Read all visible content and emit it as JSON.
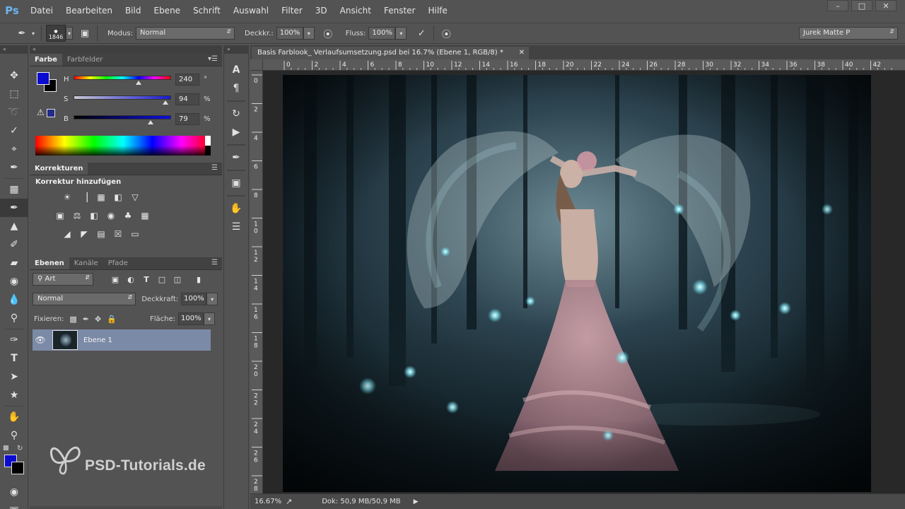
{
  "app": {
    "logo": "Ps",
    "menu": [
      "Datei",
      "Bearbeiten",
      "Bild",
      "Ebene",
      "Schrift",
      "Auswahl",
      "Filter",
      "3D",
      "Ansicht",
      "Fenster",
      "Hilfe"
    ]
  },
  "options": {
    "brush_size": "1846",
    "mode_label": "Modus:",
    "mode_value": "Normal",
    "opacity_label": "Deckkr.:",
    "opacity_value": "100%",
    "flow_label": "Fluss:",
    "flow_value": "100%",
    "workspace": "Jurek Matte P"
  },
  "color_panel": {
    "tabs": [
      "Farbe",
      "Farbfelder"
    ],
    "fg_color": "#0a0ad0",
    "bg_color": "#000000",
    "h": {
      "label": "H",
      "value": "240",
      "unit": "°",
      "fraction": 0.667
    },
    "s": {
      "label": "S",
      "value": "94",
      "unit": "%",
      "fraction": 0.94
    },
    "b": {
      "label": "B",
      "value": "79",
      "unit": "%",
      "fraction": 0.79
    }
  },
  "adjustments": {
    "tab": "Korrekturen",
    "title": "Korrektur hinzufügen"
  },
  "layers_panel": {
    "tabs": [
      "Ebenen",
      "Kanäle",
      "Pfade"
    ],
    "filter": "Art",
    "blend_mode": "Normal",
    "opacity_label": "Deckkraft:",
    "opacity_value": "100%",
    "lock_label": "Fixieren:",
    "fill_label": "Fläche:",
    "fill_value": "100%",
    "layer_name": "Ebene 1"
  },
  "document": {
    "title": "Basis Farblook_ Verlaufsumsetzung.psd bei 16.7% (Ebene 1, RGB/8) *",
    "ruler_top": [
      "0",
      "2",
      "4",
      "6",
      "8",
      "10",
      "12",
      "14",
      "16",
      "18",
      "20",
      "22",
      "24",
      "26",
      "28",
      "30",
      "32",
      "34",
      "36",
      "38",
      "40",
      "42"
    ],
    "ruler_left": [
      "0",
      "2",
      "4",
      "6",
      "8",
      "1 0",
      "1 2",
      "1 4",
      "1 6",
      "1 8",
      "2 0",
      "2 2",
      "2 4",
      "2 6",
      "2 8"
    ],
    "zoom": "16.67%",
    "info": "Dok: 50,9 MB/50,9 MB"
  },
  "watermark": {
    "text": "PSD-Tutorials.de"
  }
}
